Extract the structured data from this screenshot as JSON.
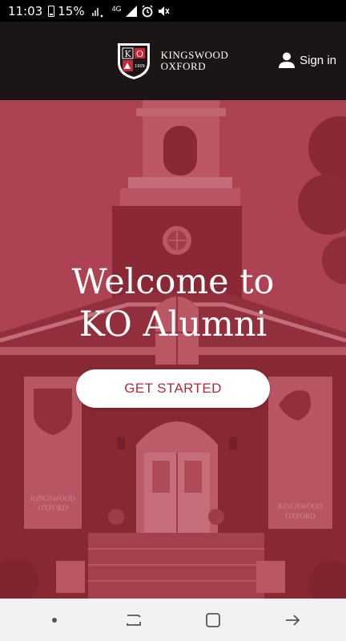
{
  "status_bar": {
    "time": "11:03",
    "battery": "15%",
    "network": "4G"
  },
  "header": {
    "logo_line1": "KINGSWOOD",
    "logo_line2": "OXFORD",
    "logo_letters": [
      "K",
      "O"
    ],
    "logo_year": "1909",
    "sign_in": "Sign in"
  },
  "hero": {
    "title_line1": "Welcome to",
    "title_line2": "KO Alumni",
    "cta": "GET STARTED",
    "banner_left_line1": "KINGSWOOD",
    "banner_left_line2": "OXFORD",
    "banner_right_line1": "KINGSWOOD",
    "banner_right_line2": "OXFORD"
  },
  "colors": {
    "brand_red": "#b02a3a",
    "overlay": "#9a2f3c",
    "header_bg": "#1c1515"
  },
  "icons": [
    "battery-icon",
    "signal-icon",
    "alarm-icon",
    "mute-icon",
    "user-icon",
    "home-dot-icon",
    "recents-icon",
    "home-icon",
    "back-icon"
  ]
}
